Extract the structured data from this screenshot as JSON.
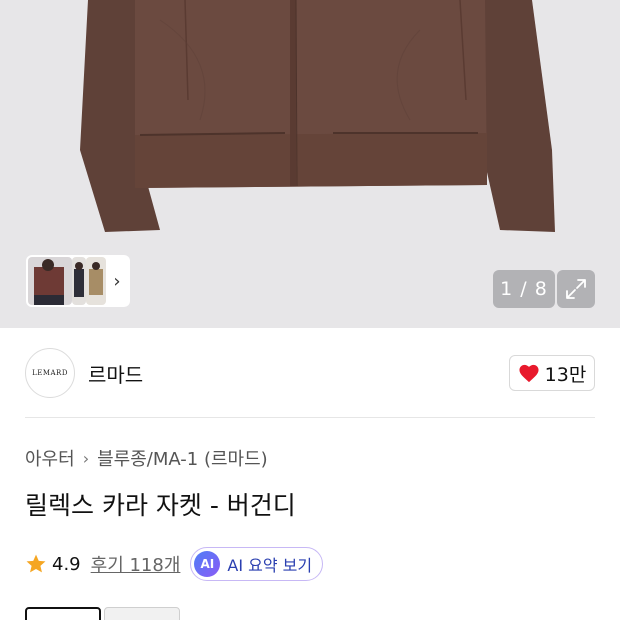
{
  "gallery": {
    "counter_text": "1 / 8",
    "expand_icon": "expand-icon",
    "thumbnail_next_icon": "chevron-right-icon"
  },
  "brand": {
    "logo_text": "LEMARD",
    "name": "르마드",
    "likes_count": "13만",
    "like_icon": "heart-icon"
  },
  "breadcrumb": {
    "category": "아우터",
    "subcategory": "블루종/MA-1 (르마드)"
  },
  "product": {
    "title": "릴렉스 카라 자켓 - 버건디"
  },
  "rating": {
    "score": "4.9",
    "reviews_label": "후기 118개",
    "ai_badge": "AI",
    "ai_summary_label": "AI 요약 보기"
  },
  "colors": {
    "jacket": "#6b4a40",
    "accent_heart": "#e8192c",
    "star": "#f5a623",
    "ai_gradient_start": "#4f7df7",
    "ai_gradient_end": "#8a5cf5"
  }
}
